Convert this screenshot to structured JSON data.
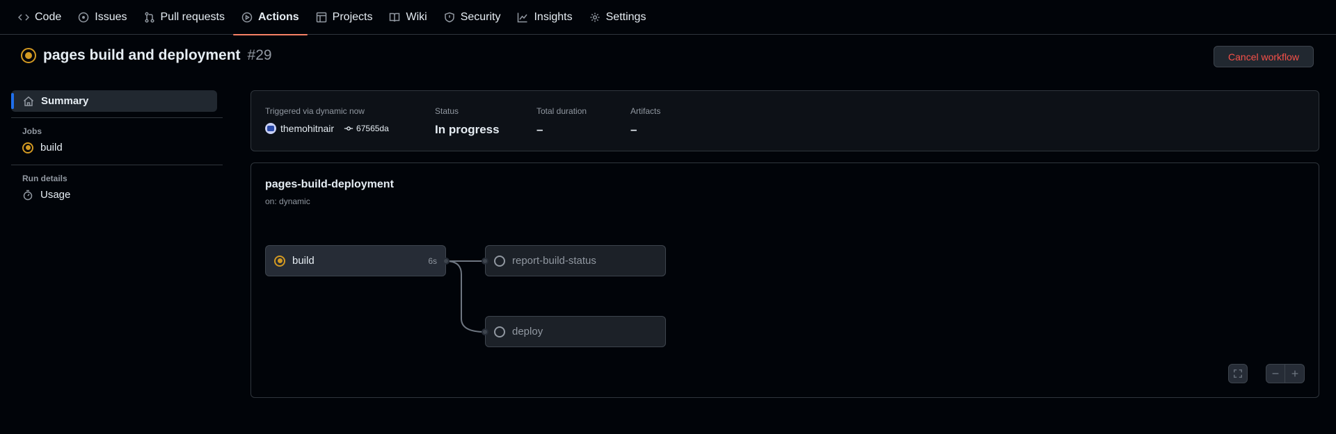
{
  "nav": [
    {
      "label": "Code",
      "icon": "code-icon"
    },
    {
      "label": "Issues",
      "icon": "issue-icon"
    },
    {
      "label": "Pull requests",
      "icon": "pull-request-icon"
    },
    {
      "label": "Actions",
      "icon": "play-icon",
      "active": true
    },
    {
      "label": "Projects",
      "icon": "table-icon"
    },
    {
      "label": "Wiki",
      "icon": "book-icon"
    },
    {
      "label": "Security",
      "icon": "shield-icon"
    },
    {
      "label": "Insights",
      "icon": "graph-icon"
    },
    {
      "label": "Settings",
      "icon": "gear-icon"
    }
  ],
  "run": {
    "title": "pages build and deployment",
    "number": "#29",
    "cancel_label": "Cancel workflow"
  },
  "sidebar": {
    "summary": "Summary",
    "jobs_heading": "Jobs",
    "job": "build",
    "details_heading": "Run details",
    "usage": "Usage"
  },
  "summary": {
    "triggered_label": "Triggered via dynamic now",
    "actor": "themohitnair",
    "commit": "67565da",
    "status_label": "Status",
    "status_value": "In progress",
    "duration_label": "Total duration",
    "duration_value": "–",
    "artifacts_label": "Artifacts",
    "artifacts_value": "–"
  },
  "workflow": {
    "name": "pages-build-deployment",
    "trigger": "on: dynamic",
    "jobs": {
      "build": {
        "label": "build",
        "duration": "6s"
      },
      "report": {
        "label": "report-build-status"
      },
      "deploy": {
        "label": "deploy"
      }
    }
  },
  "colors": {
    "accent": "#f78166",
    "in_progress": "#d29922",
    "danger": "#f85149",
    "selected_bar": "#1f6feb"
  }
}
